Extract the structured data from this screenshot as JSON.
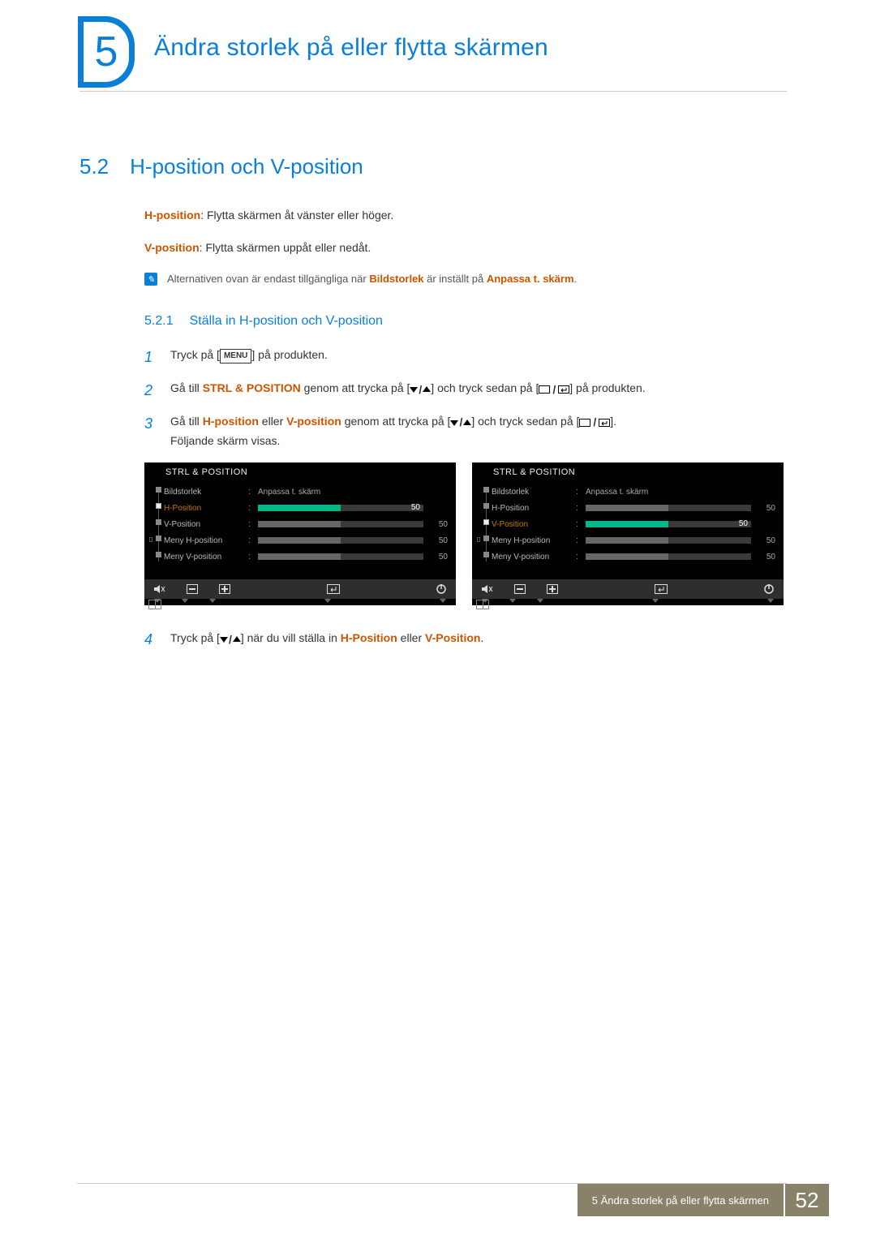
{
  "chapter": {
    "number": "5",
    "title": "Ändra storlek på eller flytta skärmen"
  },
  "section": {
    "number": "5.2",
    "title": "H-position och V-position"
  },
  "definitions": {
    "hpos_label": "H-position",
    "hpos_text": ": Flytta skärmen åt vänster eller höger.",
    "vpos_label": "V-position",
    "vpos_text": ": Flytta skärmen uppåt eller nedåt."
  },
  "note": {
    "pre": "Alternativen ovan är endast tillgängliga när ",
    "bold1": "Bildstorlek",
    "mid": " är inställt på ",
    "bold2": "Anpassa t. skärm",
    "post": "."
  },
  "subsection": {
    "number": "5.2.1",
    "title": "Ställa in H-position och V-position"
  },
  "steps": {
    "s1_pre": "Tryck på [",
    "s1_menu": "MENU",
    "s1_post": "] på produkten.",
    "s2_pre": "Gå till ",
    "s2_bold": "STRL & POSITION",
    "s2_mid1": " genom att trycka på [",
    "s2_mid2": "] och tryck sedan på [",
    "s2_post": "] på produkten.",
    "s3_pre": "Gå till ",
    "s3_b1": "H-position",
    "s3_or": " eller ",
    "s3_b2": "V-position",
    "s3_mid1": " genom att trycka på [",
    "s3_mid2": "] och tryck sedan på [",
    "s3_post": "].",
    "s3_line2": "Följande skärm visas.",
    "s4_pre": "Tryck på [",
    "s4_mid": "] när du vill ställa in ",
    "s4_b1": "H-Position",
    "s4_or": " eller ",
    "s4_b2": "V-Position",
    "s4_post": "."
  },
  "osd": {
    "title": "STRL & POSITION",
    "rows": {
      "bildstorlek": "Bildstorlek",
      "hpos": "H-Position",
      "vpos": "V-Position",
      "menyh": "Meny H-position",
      "menyv": "Meny V-position"
    },
    "value_text": "Anpassa t. skärm",
    "value_50": "50"
  },
  "footer": {
    "text": "5 Ändra storlek på eller flytta skärmen",
    "page": "52"
  }
}
